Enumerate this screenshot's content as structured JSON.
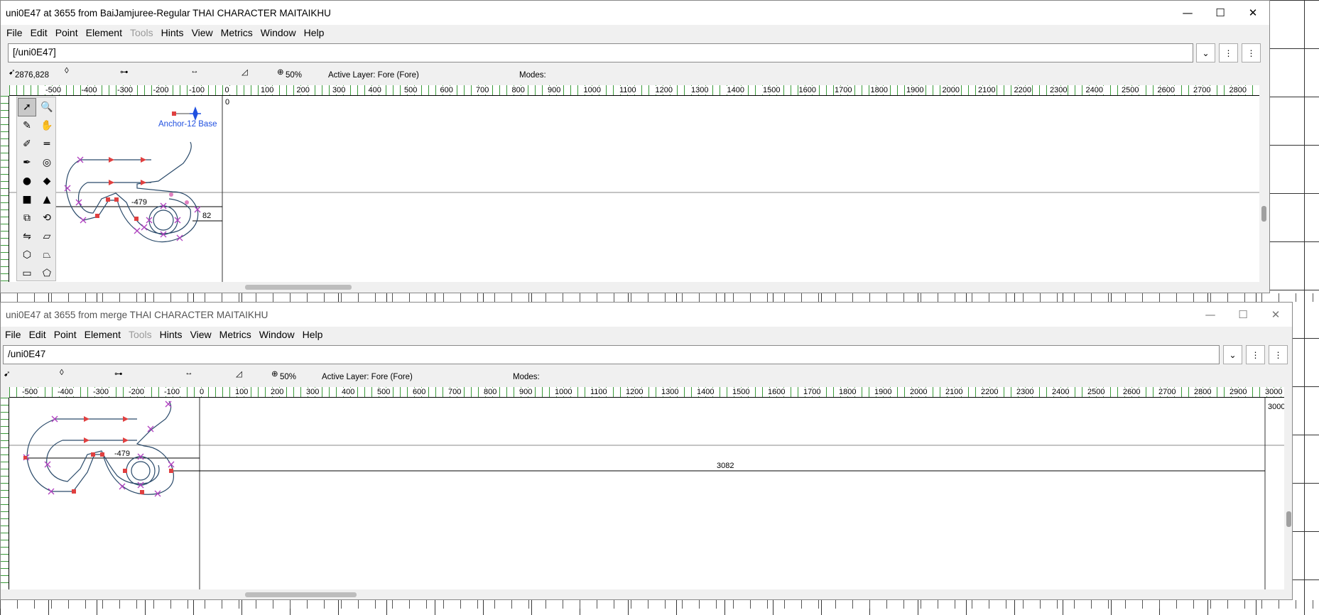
{
  "windows": [
    {
      "id": "top",
      "title": "uni0E47 at 3655 from BaiJamjuree-Regular THAI CHARACTER MAITAIKHU",
      "glyph_name_field": "[/uni0E47]",
      "coords": "2876,828",
      "zoom": "50%",
      "active_layer": "Active Layer: Fore (Fore)",
      "modes_label": "Modes:",
      "origin_label": "0",
      "anchor_label": "Anchor-12 Base",
      "dim_left": "-479",
      "dim_right": "82",
      "ruler_ticks": [
        "-500",
        "-400",
        "-300",
        "-200",
        "-100",
        "0",
        "100",
        "200",
        "300",
        "400",
        "500",
        "600",
        "700",
        "800",
        "900",
        "1000",
        "1100",
        "1200",
        "1300",
        "1400",
        "1500",
        "1600",
        "1700",
        "1800",
        "1900",
        "2000",
        "2100",
        "2200",
        "2300",
        "2400",
        "2500",
        "2600",
        "2700",
        "2800"
      ]
    },
    {
      "id": "bottom",
      "title": "uni0E47 at 3655 from merge THAI CHARACTER MAITAIKHU",
      "glyph_name_field": "/uni0E47",
      "zoom": "50%",
      "active_layer": "Active Layer: Fore (Fore)",
      "modes_label": "Modes:",
      "dim_left": "-479",
      "dim_width": "3082",
      "right_label": "3000",
      "ruler_ticks": [
        "-500",
        "-400",
        "-300",
        "-200",
        "-100",
        "0",
        "100",
        "200",
        "300",
        "400",
        "500",
        "600",
        "700",
        "800",
        "900",
        "1000",
        "1100",
        "1200",
        "1300",
        "1400",
        "1500",
        "1600",
        "1700",
        "1800",
        "1900",
        "2000",
        "2100",
        "2200",
        "2300",
        "2400",
        "2500",
        "2600",
        "2700",
        "2800",
        "2900",
        "3000"
      ]
    }
  ],
  "menu": [
    "File",
    "Edit",
    "Point",
    "Element",
    "Tools",
    "Hints",
    "View",
    "Metrics",
    "Window",
    "Help"
  ],
  "menu_disabled": [
    "Tools"
  ],
  "window_controls": {
    "minimize": "—",
    "maximize": "☐",
    "close": "✕"
  },
  "icons": {
    "name_dropdown": "chevron-down-icon",
    "name_btn2": "more-icon",
    "name_btn3": "more-icon"
  },
  "colors": {
    "accent_ruler": "#3a9a3a",
    "outline": "#2a4a6a",
    "point_magenta": "#b040c0",
    "point_red": "#e04040",
    "anchor_blue": "#2050e0"
  }
}
